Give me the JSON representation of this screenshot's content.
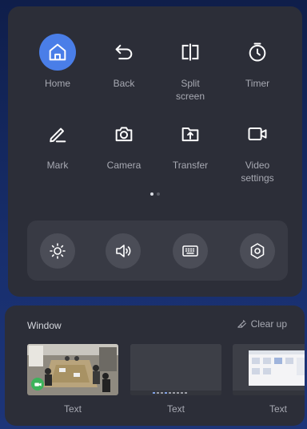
{
  "grid": {
    "items": [
      {
        "label": "Home",
        "icon": "home-icon"
      },
      {
        "label": "Back",
        "icon": "back-icon"
      },
      {
        "label": "Split\nscreen",
        "icon": "split-screen-icon"
      },
      {
        "label": "Timer",
        "icon": "timer-icon"
      },
      {
        "label": "Mark",
        "icon": "pen-icon"
      },
      {
        "label": "Camera",
        "icon": "camera-icon"
      },
      {
        "label": "Transfer",
        "icon": "upload-icon"
      },
      {
        "label": "Video\nsettings",
        "icon": "video-camera-icon"
      }
    ]
  },
  "pager": {
    "pages": 2,
    "current": 1
  },
  "quickbar": {
    "buttons": [
      {
        "icon": "brightness-icon"
      },
      {
        "icon": "volume-icon"
      },
      {
        "icon": "keyboard-icon"
      },
      {
        "icon": "settings-icon"
      }
    ]
  },
  "window": {
    "title": "Window",
    "clear_label": "Clear up",
    "thumbs": [
      {
        "label": "Text"
      },
      {
        "label": "Text"
      },
      {
        "label": "Text"
      }
    ]
  },
  "colors": {
    "accent": "#4a7ee8",
    "panel": "#2c2e38",
    "video_badge": "#3cb35a"
  }
}
